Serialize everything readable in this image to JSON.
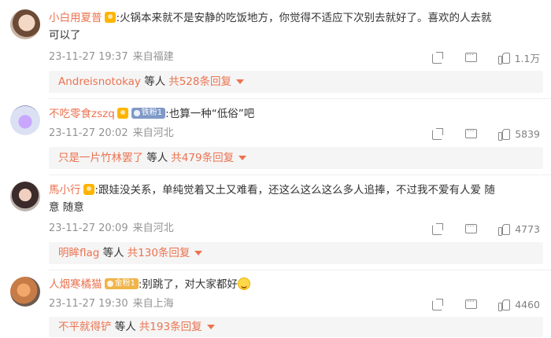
{
  "comments": [
    {
      "username": "小白用夏普",
      "badge": null,
      "text_line1": ":火锅本来就不是安静的吃饭地方，你觉得不适应下次别去就好了。喜欢的人去就",
      "text_line2": "可以了",
      "time": "23-11-27 19:37",
      "location": "来自福建",
      "likes": "1.1万",
      "replies": {
        "who": "Andreisnotokay",
        "middle": "等人",
        "count": "共528条回复"
      }
    },
    {
      "username": "不吃零食zszq",
      "badge": "铁粉1",
      "text_line1": ":也算一种“低俗”吧",
      "time": "23-11-27 20:02",
      "location": "来自河北",
      "likes": "5839",
      "replies": {
        "who": "只是一片竹林罢了",
        "middle": "等人",
        "count": "共479条回复"
      }
    },
    {
      "username": "馬小行",
      "badge": null,
      "text_line1": ":跟娃没关系，单纯觉着又土又难看，还这么这么这么多人追捧，不过我不爱有人爱 随",
      "text_line2": "意 随意",
      "time": "23-11-27 20:09",
      "location": "来自河北",
      "likes": "4773",
      "replies": {
        "who": "明眸flag",
        "middle": "等人",
        "count": "共130条回复"
      }
    },
    {
      "username": "人烟寒橘猫",
      "badge": "金粉1",
      "text_line1": ":别跳了，对大家都好",
      "time": "23-11-27 19:30",
      "location": "来自上海",
      "likes": "4460",
      "replies": {
        "who": "不平就得铲",
        "middle": "等人",
        "count": "共193条回复"
      }
    }
  ],
  "icons": {
    "share": "share-icon",
    "comment": "comment-icon",
    "like": "thumbs-up-icon",
    "vip": "vip-crown-icon",
    "emoji": "grinning-emoji-icon"
  },
  "colors": {
    "accent": "#eb7350",
    "meta": "#939393",
    "reply_bg": "#f5f5f5"
  }
}
